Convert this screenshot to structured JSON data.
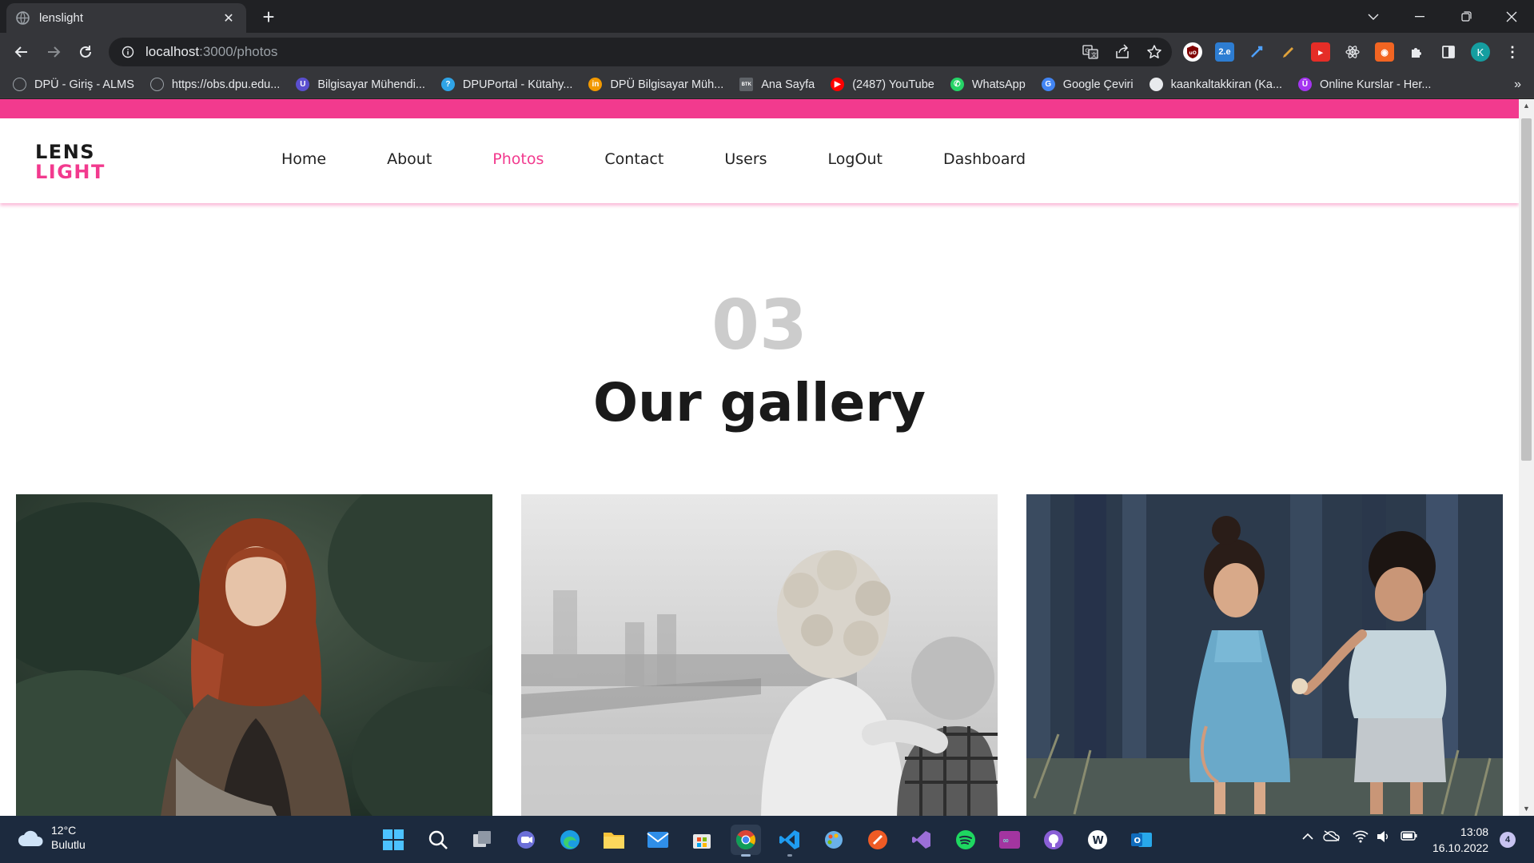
{
  "browser": {
    "tab_title": "lenslight",
    "url_host": "localhost",
    "url_path": ":3000/photos",
    "profile_initial": "K",
    "bookmarks": [
      {
        "label": "DPÜ - Giriş - ALMS",
        "icon": "globe-icon",
        "color": "#9aa0a6"
      },
      {
        "label": "https://obs.dpu.edu...",
        "icon": "globe-icon",
        "color": "#9aa0a6"
      },
      {
        "label": "Bilgisayar Mühendi...",
        "icon": "university-icon",
        "color": "#5a4fcf"
      },
      {
        "label": "DPUPortal - Kütahy...",
        "icon": "portal-icon",
        "color": "#2fa4e7"
      },
      {
        "label": "DPÜ Bilgisayar Müh...",
        "icon": "bars-icon",
        "color": "#f29900"
      },
      {
        "label": "Ana Sayfa",
        "icon": "btk-icon",
        "color": "#5f6368"
      },
      {
        "label": "(2487) YouTube",
        "icon": "youtube-icon",
        "color": "#ff0000"
      },
      {
        "label": "WhatsApp",
        "icon": "whatsapp-icon",
        "color": "#25d366"
      },
      {
        "label": "Google Çeviri",
        "icon": "translate-icon",
        "color": "#4285f4"
      },
      {
        "label": "kaankaltakkiran (Ka...",
        "icon": "github-icon",
        "color": "#e8eaed"
      },
      {
        "label": "Online Kurslar - Her...",
        "icon": "udemy-icon",
        "color": "#a435f0"
      }
    ]
  },
  "site": {
    "logo_line1": "LENS",
    "logo_line2": "LIGHT",
    "nav": [
      "Home",
      "About",
      "Photos",
      "Contact",
      "Users",
      "LogOut",
      "Dashboard"
    ],
    "active_nav": "Photos",
    "section_number": "03",
    "section_title": "Our gallery",
    "gallery": [
      {
        "subject": "red-haired woman in green foliage"
      },
      {
        "subject": "two children hugging, black and white"
      },
      {
        "subject": "two children exchanging a flower"
      }
    ],
    "colors": {
      "accent": "#f23a8e",
      "text": "#1a1a1a",
      "muted": "#cccccc"
    }
  },
  "taskbar": {
    "temperature": "12°C",
    "condition": "Bulutlu",
    "time": "13:08",
    "date": "16.10.2022",
    "notification_count": "4"
  }
}
